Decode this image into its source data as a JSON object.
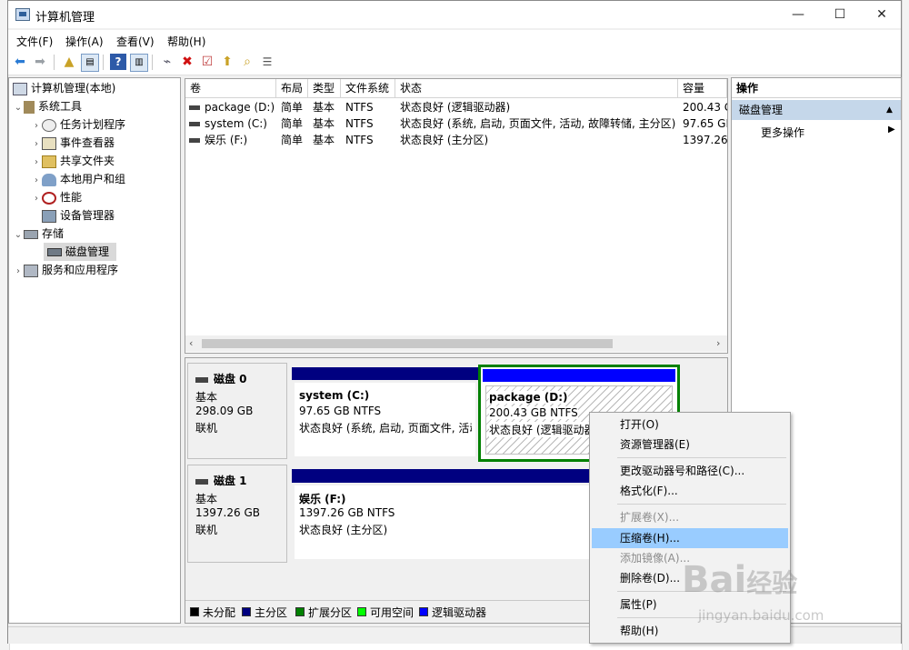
{
  "window": {
    "title": "计算机管理",
    "minimize": "—",
    "maximize": "☐",
    "close": "✕"
  },
  "menu": [
    "文件(F)",
    "操作(A)",
    "查看(V)",
    "帮助(H)"
  ],
  "tree": {
    "root": "计算机管理(本地)",
    "system_tools": "系统工具",
    "task_scheduler": "任务计划程序",
    "event_viewer": "事件查看器",
    "shared_folders": "共享文件夹",
    "local_users": "本地用户和组",
    "performance": "性能",
    "device_manager": "设备管理器",
    "storage": "存储",
    "disk_management": "磁盘管理",
    "services_apps": "服务和应用程序"
  },
  "volumes": {
    "headers": [
      "卷",
      "布局",
      "类型",
      "文件系统",
      "状态",
      "容量"
    ],
    "rows": [
      [
        "package (D:)",
        "简单",
        "基本",
        "NTFS",
        "状态良好 (逻辑驱动器)",
        "200.43 G"
      ],
      [
        "system (C:)",
        "简单",
        "基本",
        "NTFS",
        "状态良好 (系统, 启动, 页面文件, 活动, 故障转储, 主分区)",
        "97.65 GB"
      ],
      [
        "娱乐 (F:)",
        "简单",
        "基本",
        "NTFS",
        "状态良好 (主分区)",
        "1397.26"
      ]
    ]
  },
  "disks": [
    {
      "name": "磁盘 0",
      "type": "基本",
      "size": "298.09 GB",
      "status": "联机",
      "partitions": [
        {
          "name": "system (C:)",
          "size": "97.65 GB NTFS",
          "status": "状态良好 (系统, 启动, 页面文件, 活动"
        },
        {
          "name": "package (D:)",
          "size": "200.43 GB NTFS",
          "status": "状态良好 (逻辑驱动器)"
        }
      ]
    },
    {
      "name": "磁盘 1",
      "type": "基本",
      "size": "1397.26 GB",
      "status": "联机",
      "partitions": [
        {
          "name": "娱乐 (F:)",
          "size": "1397.26 GB NTFS",
          "status": "状态良好 (主分区)"
        }
      ]
    }
  ],
  "legend": [
    {
      "label": "未分配",
      "color": "#000000"
    },
    {
      "label": "主分区",
      "color": "#000080"
    },
    {
      "label": "扩展分区",
      "color": "#008000"
    },
    {
      "label": "可用空间",
      "color": "#00ff00"
    },
    {
      "label": "逻辑驱动器",
      "color": "#0000ff"
    }
  ],
  "actions": {
    "header": "操作",
    "section": "磁盘管理",
    "more": "更多操作"
  },
  "context_menu": [
    {
      "label": "打开(O)",
      "enabled": true
    },
    {
      "label": "资源管理器(E)",
      "enabled": true
    },
    {
      "label": "更改驱动器号和路径(C)...",
      "enabled": true
    },
    {
      "label": "格式化(F)...",
      "enabled": true
    },
    {
      "label": "扩展卷(X)...",
      "enabled": false
    },
    {
      "label": "压缩卷(H)...",
      "enabled": true,
      "highlighted": true
    },
    {
      "label": "添加镜像(A)...",
      "enabled": false
    },
    {
      "label": "删除卷(D)...",
      "enabled": true
    },
    {
      "label": "属性(P)",
      "enabled": true
    },
    {
      "label": "帮助(H)",
      "enabled": true
    }
  ],
  "watermark": {
    "brand": "Bai",
    "brand2": "经验",
    "url": "jingyan.baidu.com"
  },
  "colors": {
    "primary": "#000080",
    "logical": "#0000ff",
    "highlight": "#99ccff",
    "selected_border": "#008000"
  }
}
